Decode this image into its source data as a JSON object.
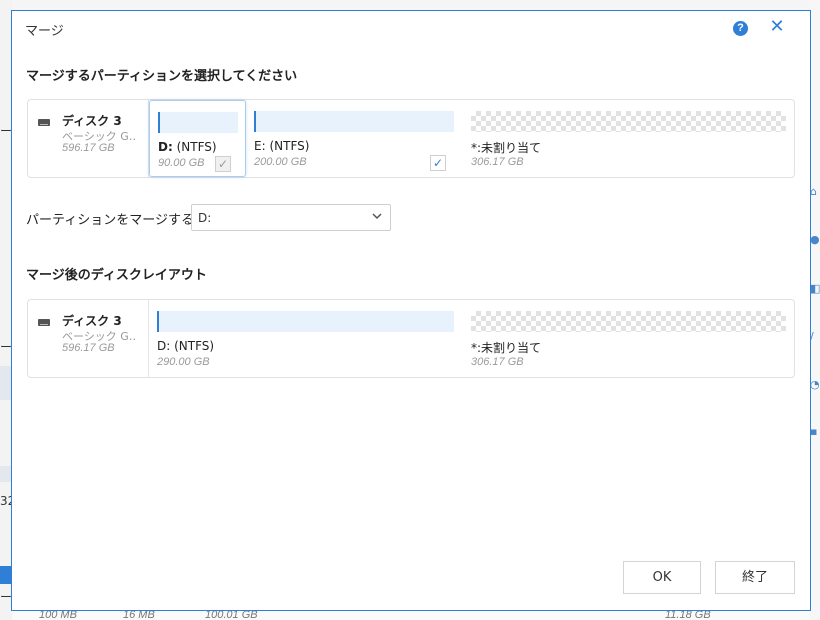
{
  "background": {
    "left_fragments": [
      "ー",
      "ー",
      "32",
      "ー"
    ],
    "bottom_values": [
      "100 MB",
      "16 MB",
      "100.01 GB",
      "11.18 GB"
    ]
  },
  "dialog": {
    "title": "マージ",
    "help_icon_glyph": "?",
    "close_icon_glyph": "✕"
  },
  "select_section": {
    "title": "マージするパーティションを選択してください",
    "disk": {
      "name": "ディスク 3",
      "type": "ベーシック G‥",
      "size": "596.17 GB"
    },
    "partitions": [
      {
        "letter": "D:",
        "fs": "(NTFS)",
        "size": "90.00 GB",
        "checked": true,
        "disabled": true
      },
      {
        "letter": "E:",
        "fs": "(NTFS)",
        "size": "200.00 GB",
        "checked": true,
        "disabled": false
      },
      {
        "letter": "*:",
        "fs": "未割り当て",
        "size": "306.17 GB"
      }
    ]
  },
  "merge_to": {
    "label": "パーティションをマージする:",
    "selected": "D:"
  },
  "result_section": {
    "title": "マージ後のディスクレイアウト",
    "disk": {
      "name": "ディスク 3",
      "type": "ベーシック G‥",
      "size": "596.17 GB"
    },
    "partitions": [
      {
        "letter": "D:",
        "fs": "(NTFS)",
        "size": "290.00 GB"
      },
      {
        "letter": "*:",
        "fs": "未割り当て",
        "size": "306.17 GB"
      }
    ]
  },
  "buttons": {
    "ok": "OK",
    "finish": "終了"
  },
  "colors": {
    "accent": "#2f7fd6",
    "partition_bar": "#e8f2fc",
    "muted_text": "#9a9a9a"
  }
}
